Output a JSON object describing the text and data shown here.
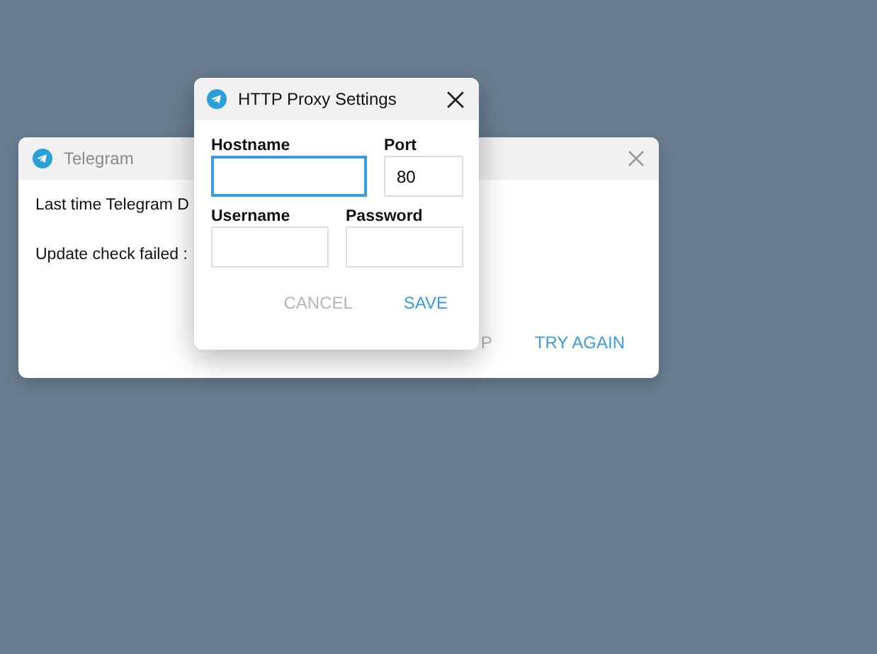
{
  "back_dialog": {
    "title": "Telegram",
    "lines": [
      "Last time Telegram D",
      "Update check failed :"
    ],
    "buttons": [
      {
        "label": "P",
        "kind": "partial"
      },
      {
        "label": "TRY AGAIN",
        "kind": "primary"
      }
    ]
  },
  "proxy_dialog": {
    "title": "HTTP Proxy Settings",
    "fields": [
      {
        "label": "Hostname",
        "focused": true
      },
      {
        "label": "Port",
        "value": "80",
        "focused": false
      },
      {
        "label": "Username",
        "focused": false
      },
      {
        "label": "Password",
        "focused": false
      }
    ],
    "buttons": [
      {
        "label": "CANCEL",
        "kind": "secondary"
      },
      {
        "label": "SAVE",
        "kind": "primary"
      }
    ]
  }
}
